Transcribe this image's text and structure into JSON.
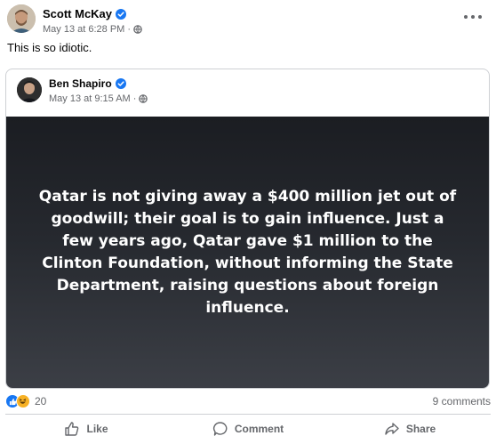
{
  "post": {
    "author": "Scott McKay",
    "timestamp": "May 13 at 6:28 PM",
    "separator": "·",
    "text": "This is so idiotic."
  },
  "shared": {
    "author": "Ben Shapiro",
    "timestamp": "May 13 at 9:15 AM",
    "separator": "·",
    "quote": "Qatar is not giving away a $400 million jet out of goodwill; their goal is to gain influence. Just a few years ago, Qatar gave $1 million to the Clinton Foundation, without informing the State Department, raising questions about foreign influence."
  },
  "engagement": {
    "reaction_count": "20",
    "comments": "9 comments",
    "reactions": [
      "like-icon",
      "haha-icon"
    ]
  },
  "actions": {
    "like": "Like",
    "comment": "Comment",
    "share": "Share"
  },
  "colors": {
    "verified": "#1877f2",
    "secondary_text": "#65676b",
    "like_blue": "#1877f2",
    "haha_yellow": "#f7b125"
  }
}
